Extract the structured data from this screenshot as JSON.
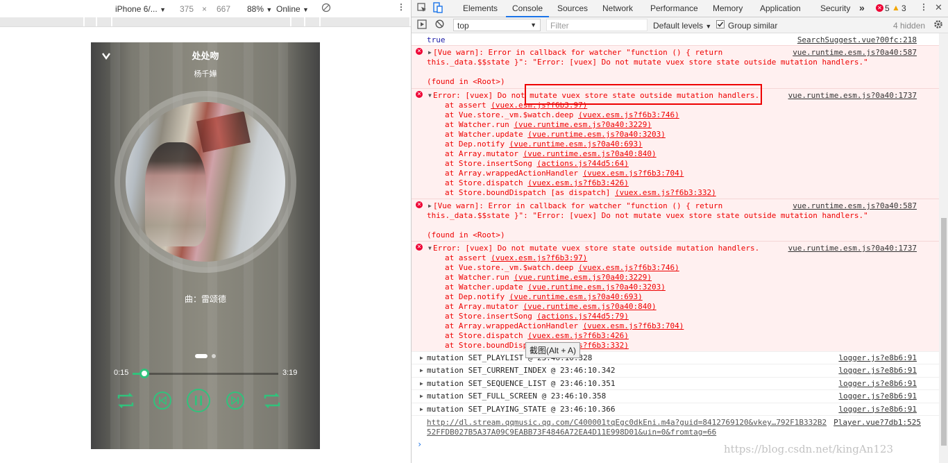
{
  "device_toolbar": {
    "device": "iPhone 6/...",
    "width": "375",
    "times": "×",
    "height": "667",
    "zoom": "88%",
    "throttle": "Online"
  },
  "player": {
    "song_title": "处处吻",
    "singer": "杨千嬅",
    "lyric": "曲：雷颂德",
    "current_time": "0:15",
    "duration": "3:19",
    "progress": 0.08,
    "accent_color": "#31c27c",
    "icons": [
      "back-chevron-icon",
      "loop-icon",
      "prev-icon",
      "pause-icon",
      "next-icon",
      "favorite-icon"
    ]
  },
  "devtools": {
    "tabs": [
      "Elements",
      "Console",
      "Sources",
      "Network",
      "Performance",
      "Memory",
      "Application",
      "Security"
    ],
    "active_tab": "Console",
    "more": "»",
    "errors_count": "5",
    "warnings_count": "3",
    "context": "top",
    "filter_placeholder": "Filter",
    "levels": "Default levels",
    "group_similar": "Group similar",
    "hidden": "4 hidden"
  },
  "console": {
    "true_line": "true",
    "true_src": "SearchSuggest.vue?00fc:218",
    "vue_warn_1": "[Vue warn]: Error in callback for watcher \"function () { return",
    "vue_warn_2": "this._data.$$state }\": \"Error: [vuex] Do not mutate vuex store state outside mutation handlers.\"",
    "found_in": "(found in <Root>)",
    "vue_warn_src": "vue.runtime.esm.js?0a40:587",
    "error_msg": "Error: [vuex] Do not mutate vuex store state outside mutation handlers.",
    "error_src": "vue.runtime.esm.js?0a40:1737",
    "stack_1": [
      {
        "fn": "at assert ",
        "loc": "(vuex.esm.js?f6b3:97)"
      },
      {
        "fn": "at Vue.store._vm.$watch.deep ",
        "loc": "(vuex.esm.js?f6b3:746)"
      },
      {
        "fn": "at Watcher.run ",
        "loc": "(vue.runtime.esm.js?0a40:3229)"
      },
      {
        "fn": "at Watcher.update ",
        "loc": "(vue.runtime.esm.js?0a40:3203)"
      },
      {
        "fn": "at Dep.notify ",
        "loc": "(vue.runtime.esm.js?0a40:693)"
      },
      {
        "fn": "at Array.mutator ",
        "loc": "(vue.runtime.esm.js?0a40:840)"
      },
      {
        "fn": "at Store.insertSong ",
        "loc": "(actions.js?44d5:64)"
      },
      {
        "fn": "at Array.wrappedActionHandler ",
        "loc": "(vuex.esm.js?f6b3:704)"
      },
      {
        "fn": "at Store.dispatch ",
        "loc": "(vuex.esm.js?f6b3:426)"
      },
      {
        "fn": "at Store.boundDispatch [as dispatch] ",
        "loc": "(vuex.esm.js?f6b3:332)"
      }
    ],
    "stack_2": [
      {
        "fn": "at assert ",
        "loc": "(vuex.esm.js?f6b3:97)"
      },
      {
        "fn": "at Vue.store._vm.$watch.deep ",
        "loc": "(vuex.esm.js?f6b3:746)"
      },
      {
        "fn": "at Watcher.run ",
        "loc": "(vue.runtime.esm.js?0a40:3229)"
      },
      {
        "fn": "at Watcher.update ",
        "loc": "(vue.runtime.esm.js?0a40:3203)"
      },
      {
        "fn": "at Dep.notify ",
        "loc": "(vue.runtime.esm.js?0a40:693)"
      },
      {
        "fn": "at Array.mutator ",
        "loc": "(vue.runtime.esm.js?0a40:840)"
      },
      {
        "fn": "at Store.insertSong ",
        "loc": "(actions.js?44d5:79)"
      },
      {
        "fn": "at Array.wrappedActionHandler ",
        "loc": "(vuex.esm.js?f6b3:704)"
      },
      {
        "fn": "at Store.dispatch ",
        "loc": "(vuex.esm.js?f6b3:426)"
      },
      {
        "fn": "at Store.boundDisp",
        "loc": "(vuex.esm.js?f6b3:332)"
      }
    ],
    "mutations": [
      {
        "text": "mutation SET_PLAYLIST @ 23:46:10.328",
        "src": "logger.js?e8b6:91"
      },
      {
        "text": "mutation SET_CURRENT_INDEX @ 23:46:10.342",
        "src": "logger.js?e8b6:91"
      },
      {
        "text": "mutation SET_SEQUENCE_LIST @ 23:46:10.351",
        "src": "logger.js?e8b6:91"
      },
      {
        "text": "mutation SET_FULL_SCREEN @ 23:46:10.358",
        "src": "logger.js?e8b6:91"
      },
      {
        "text": "mutation SET_PLAYING_STATE @ 23:46:10.366",
        "src": "logger.js?e8b6:91"
      }
    ],
    "url_line_1": "http://dl.stream.qqmusic.qq.com/C400001tqEgc0dkEni.m4a?guid=8412769120&vkey…792F1B332B2",
    "url_line_2": "52FFDB027B5A37A09C9EABB73F4846A72EA4D11E998D01&uin=0&fromtag=66",
    "url_src": "Player.vue?7db1:525",
    "prompt": "›"
  },
  "tooltip": "截图(Alt + A)",
  "watermark": "https://blog.csdn.net/kingAn123"
}
